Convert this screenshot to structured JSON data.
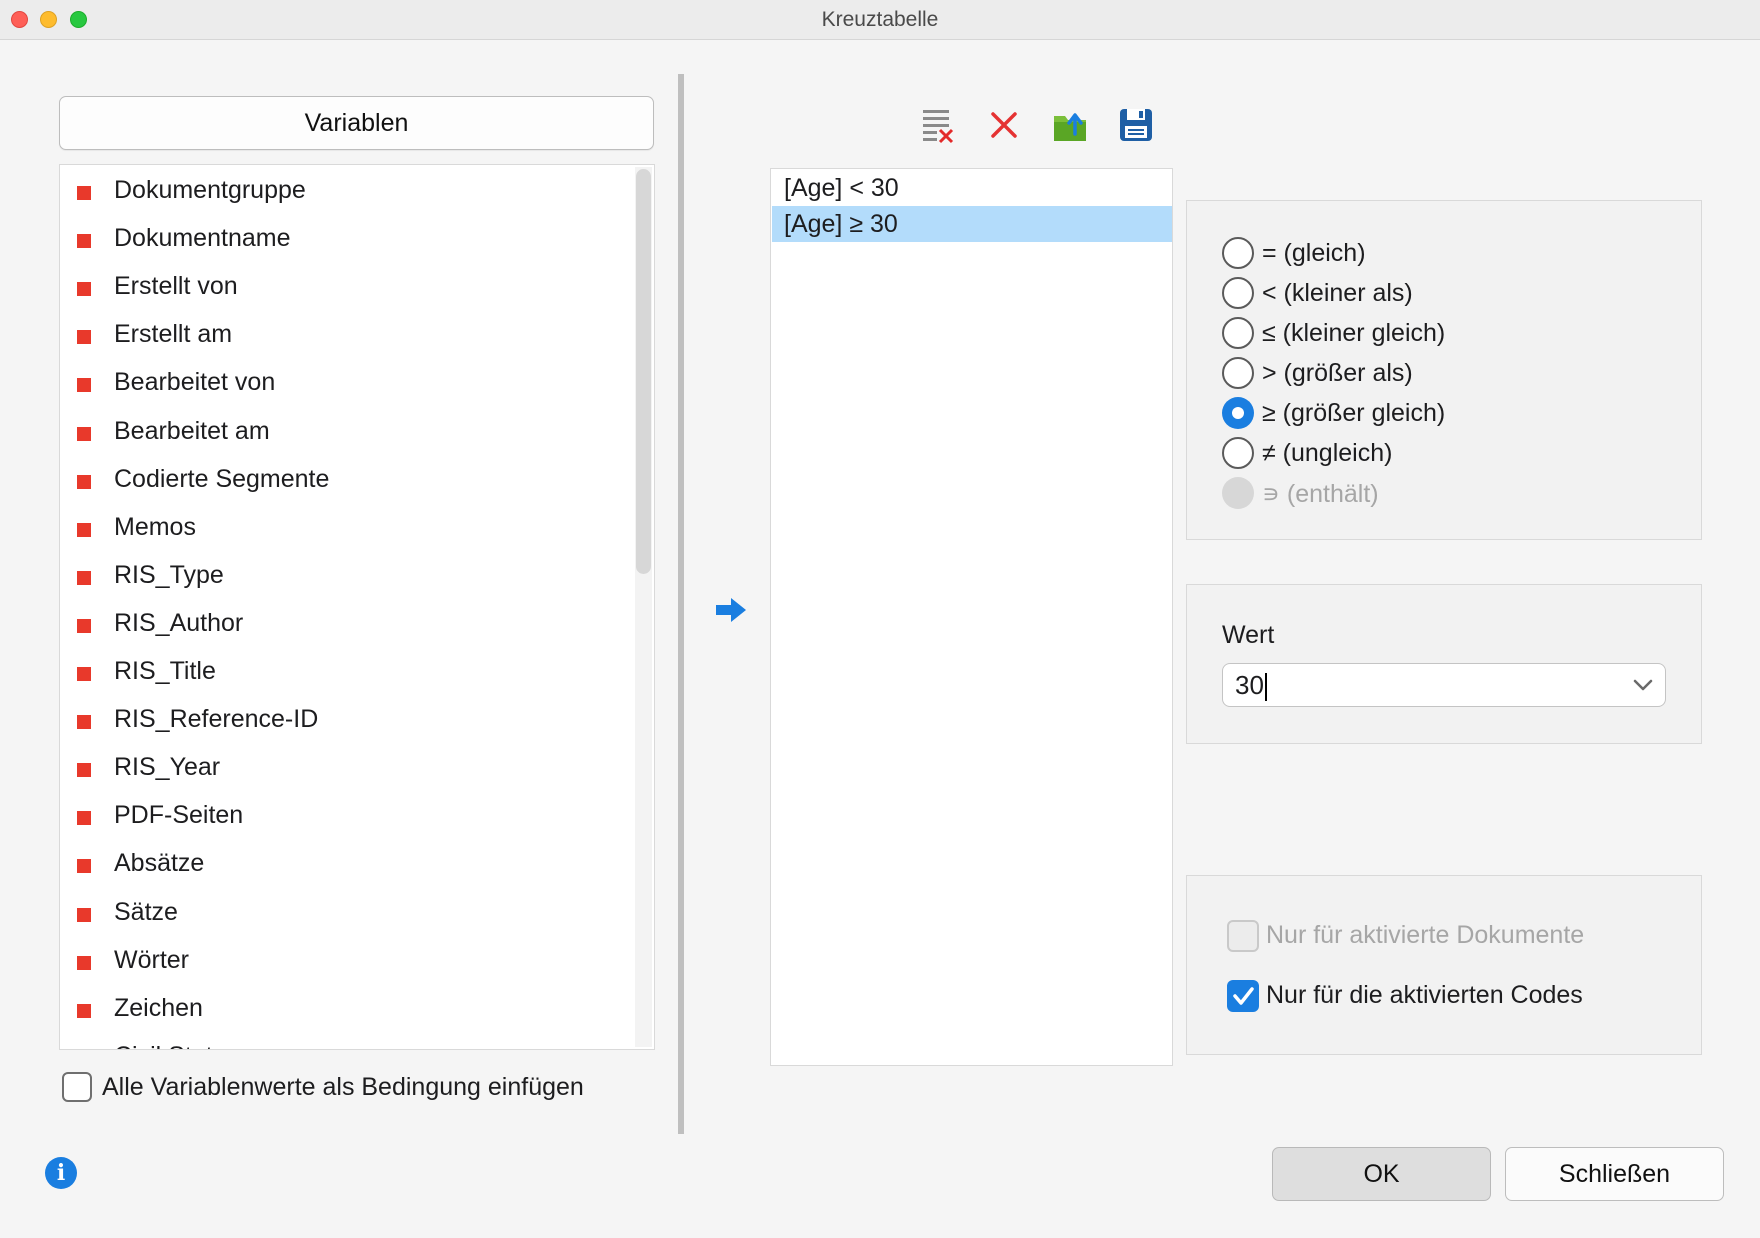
{
  "window": {
    "title": "Kreuztabelle"
  },
  "left": {
    "variables_button": "Variablen",
    "variables": [
      {
        "label": "Dokumentgruppe",
        "color": "#e8392b"
      },
      {
        "label": "Dokumentname",
        "color": "#e8392b"
      },
      {
        "label": "Erstellt von",
        "color": "#e8392b"
      },
      {
        "label": "Erstellt am",
        "color": "#e8392b"
      },
      {
        "label": "Bearbeitet von",
        "color": "#e8392b"
      },
      {
        "label": "Bearbeitet am",
        "color": "#e8392b"
      },
      {
        "label": "Codierte Segmente",
        "color": "#e8392b"
      },
      {
        "label": "Memos",
        "color": "#e8392b"
      },
      {
        "label": "RIS_Type",
        "color": "#e8392b"
      },
      {
        "label": "RIS_Author",
        "color": "#e8392b"
      },
      {
        "label": "RIS_Title",
        "color": "#e8392b"
      },
      {
        "label": "RIS_Reference-ID",
        "color": "#e8392b"
      },
      {
        "label": "RIS_Year",
        "color": "#e8392b"
      },
      {
        "label": "PDF-Seiten",
        "color": "#e8392b"
      },
      {
        "label": "Absätze",
        "color": "#e8392b"
      },
      {
        "label": "Sätze",
        "color": "#e8392b"
      },
      {
        "label": "Wörter",
        "color": "#e8392b"
      },
      {
        "label": "Zeichen",
        "color": "#e8392b"
      },
      {
        "label": "Civil Status",
        "color": "#3d7fc1"
      }
    ],
    "insert_all_checkbox": {
      "label": "Alle Variablenwerte als Bedingung einfügen",
      "checked": false
    }
  },
  "toolbar": {
    "icons": [
      "clear-list-icon",
      "delete-icon",
      "export-icon",
      "save-icon"
    ]
  },
  "conditions": {
    "items": [
      "[Age] < 30",
      "[Age] ≥ 30"
    ],
    "selected_index": 1
  },
  "operators": {
    "options": [
      {
        "label": "= (gleich)",
        "state": "off"
      },
      {
        "label": "< (kleiner als)",
        "state": "off"
      },
      {
        "label": "≤ (kleiner gleich)",
        "state": "off"
      },
      {
        "label": "> (größer als)",
        "state": "off"
      },
      {
        "label": "≥ (größer gleich)",
        "state": "on"
      },
      {
        "label": "≠ (ungleich)",
        "state": "off"
      },
      {
        "label": "∍ (enthält)",
        "state": "disabled"
      }
    ]
  },
  "value": {
    "label": "Wert",
    "current": "30"
  },
  "options": {
    "only_activated_documents": {
      "label": "Nur für aktivierte Dokumente",
      "checked": false,
      "enabled": false
    },
    "only_activated_codes": {
      "label": "Nur für die aktivierten Codes",
      "checked": true,
      "enabled": true
    }
  },
  "footer": {
    "ok_label": "OK",
    "close_label": "Schließen"
  },
  "colors": {
    "accent": "#1a7ee0",
    "selection": "#b3dcfb",
    "variable_marker": "#e8392b"
  }
}
